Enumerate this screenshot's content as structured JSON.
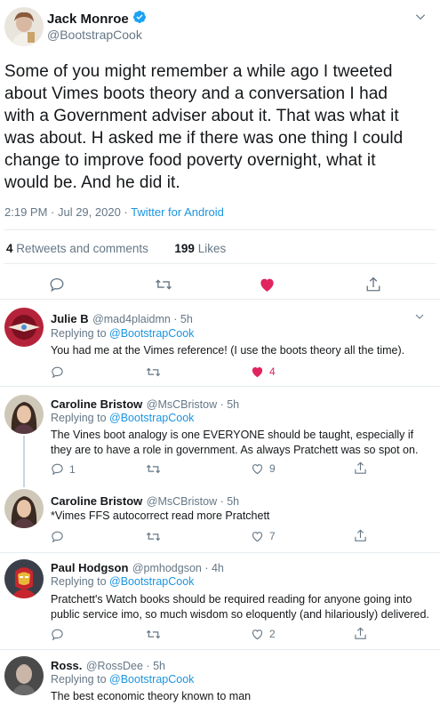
{
  "main_tweet": {
    "author_name": "Jack Monroe",
    "author_handle": "@BootstrapCook",
    "text": "Some of you might remember a while ago I tweeted about Vimes boots theory and a conversation I had with a Government adviser about it. That was what it was about. H asked me if there was one thing I could change to improve food poverty overnight, what it would be. And he did it.",
    "time": "2:19 PM · Jul 29, 2020 · ",
    "source": "Twitter for Android",
    "retweets_count": "4",
    "retweets_label": "Retweets and comments",
    "likes_count": "199",
    "likes_label": "Likes",
    "liked": true
  },
  "replies": [
    {
      "name": "Julie B",
      "handle_time": "@mad4plaidmn · 5h",
      "replying_prefix": "Replying to",
      "replying_to": "@BootstrapCook",
      "text": "You had me at the Vimes reference!  (I use the boots theory all the time).",
      "reply_count": "",
      "retweet_count": "",
      "like_count": "4",
      "liked": true
    },
    {
      "name": "Caroline Bristow",
      "handle_time": "@MsCBristow · 5h",
      "replying_prefix": "Replying to",
      "replying_to": "@BootstrapCook",
      "text": "The Vines boot analogy is one EVERYONE should be taught, especially if they are to have a role in government. As always Pratchett was so spot on.",
      "reply_count": "1",
      "retweet_count": "",
      "like_count": "9",
      "liked": false
    },
    {
      "name": "Caroline Bristow",
      "handle_time": "@MsCBristow · 5h",
      "replying_prefix": "",
      "replying_to": "",
      "text": "*Vimes FFS autocorrect read more Pratchett",
      "reply_count": "",
      "retweet_count": "",
      "like_count": "7",
      "liked": false
    },
    {
      "name": "Paul Hodgson",
      "handle_time": "@pmhodgson · 4h",
      "replying_prefix": "Replying to",
      "replying_to": "@BootstrapCook",
      "text": "Pratchett's Watch books should be required reading for anyone going into public service imo, so much wisdom so eloquently (and hilariously) delivered.",
      "reply_count": "",
      "retweet_count": "",
      "like_count": "2",
      "liked": false
    },
    {
      "name": "Ross.",
      "handle_time": "@RossDee · 5h",
      "replying_prefix": "Replying to",
      "replying_to": "@BootstrapCook",
      "text": "The best economic theory known to man"
    }
  ],
  "colors": {
    "accent": "#1b95e0",
    "like": "#e0245e",
    "muted": "#657786",
    "text": "#14171a",
    "divider": "#e6ecf0"
  },
  "icons": {
    "reply": "speech-bubble-icon",
    "retweet": "retweet-arrows-icon",
    "like": "heart-icon",
    "share": "share-upload-icon",
    "more": "chevron-down-icon",
    "verified": "verified-badge-icon"
  }
}
